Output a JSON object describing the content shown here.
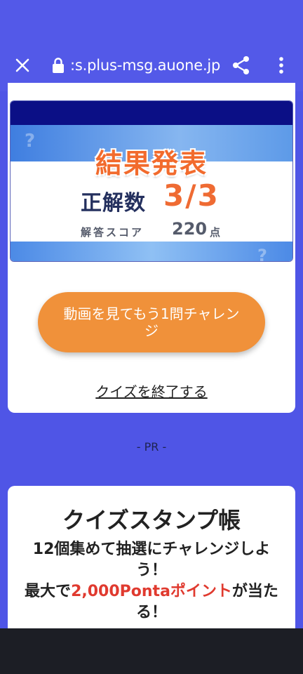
{
  "browser": {
    "url": ":s.plus-msg.auone.jp",
    "close_icon": "close-icon",
    "lock_icon": "lock-icon",
    "share_icon": "share-icon",
    "more_icon": "more-vert-icon"
  },
  "result": {
    "title": "結果発表",
    "score_label": "正解数",
    "score_value": "3/3",
    "points_label": "解答スコア",
    "points_value": "220",
    "points_unit": "点"
  },
  "actions": {
    "challenge_button": "動画を見てもう1問チャレンジ",
    "end_quiz_link": "クイズを終了する"
  },
  "pr_label": "- PR -",
  "stamp_book": {
    "title": "クイズスタンプ帳",
    "line1": "12個集めて抽選にチャレンジしよう！",
    "line2_pre": "最大で",
    "line2_highlight": "2,000Pontaポイント",
    "line2_post": "が当たる！"
  },
  "colors": {
    "background": "#4f55e6",
    "accent_orange": "#f0913a",
    "score_orange": "#ef6b33",
    "highlight_red": "#e03a2f",
    "banner_navy": "#0b0f86"
  }
}
